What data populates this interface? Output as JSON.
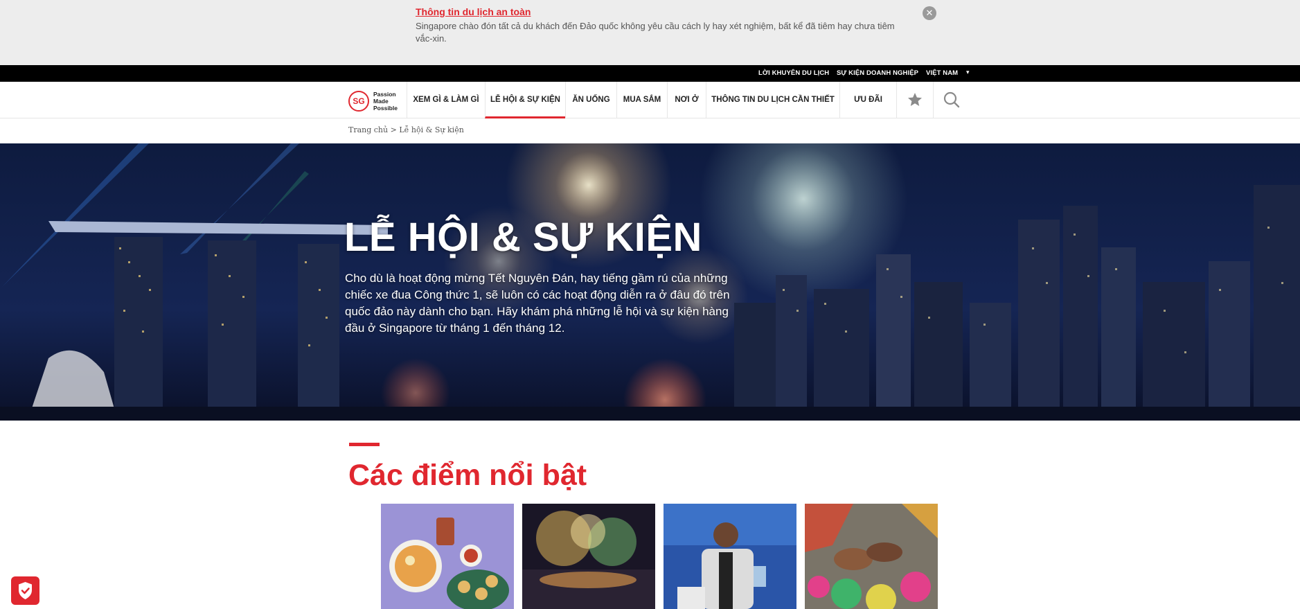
{
  "alert": {
    "title": "Thông tin du lịch an toàn",
    "text": "Singapore chào đón tất cả du khách đến Đảo quốc không yêu cầu cách ly hay xét nghiệm, bất kể đã tiêm hay chưa tiêm vắc-xin.",
    "close_icon": "close-icon"
  },
  "utility_bar": {
    "items": [
      "LỜI KHUYÊN DU LỊCH",
      "SỰ KIỆN DOANH NGHIỆP",
      "VIỆT NAM"
    ]
  },
  "logo": {
    "mark": "SG",
    "lines": [
      "Passion",
      "Made",
      "Possible"
    ]
  },
  "nav": {
    "items": [
      "XEM GÌ & LÀM GÌ",
      "LỄ HỘI & SỰ KIỆN",
      "ĂN UỐNG",
      "MUA SẮM",
      "NƠI Ở",
      "THÔNG TIN DU LỊCH CẦN THIẾT",
      "ƯU ĐÃI"
    ],
    "active": "LỄ HỘI & SỰ KIỆN",
    "icons": [
      "star-icon",
      "search-icon"
    ]
  },
  "breadcrumb": "Trang chủ > Lễ hội & Sự kiện",
  "hero": {
    "title": "LỄ HỘI & SỰ KIỆN",
    "description": "Cho dù là hoạt động mừng Tết Nguyên Đán, hay tiếng gầm rú của những chiếc xe đua Công thức 1, sẽ luôn có các hoạt động diễn ra ở đâu đó trên quốc đảo này dành cho bạn. Hãy khám phá những lễ hội và sự kiện hàng đầu ở Singapore từ tháng 1 đến tháng 12."
  },
  "highlights": {
    "title": "Các điểm nổi bật"
  },
  "colors": {
    "brand_red": "#e0272f",
    "utility_bar": "#000000",
    "alert_bg": "#ededed"
  }
}
